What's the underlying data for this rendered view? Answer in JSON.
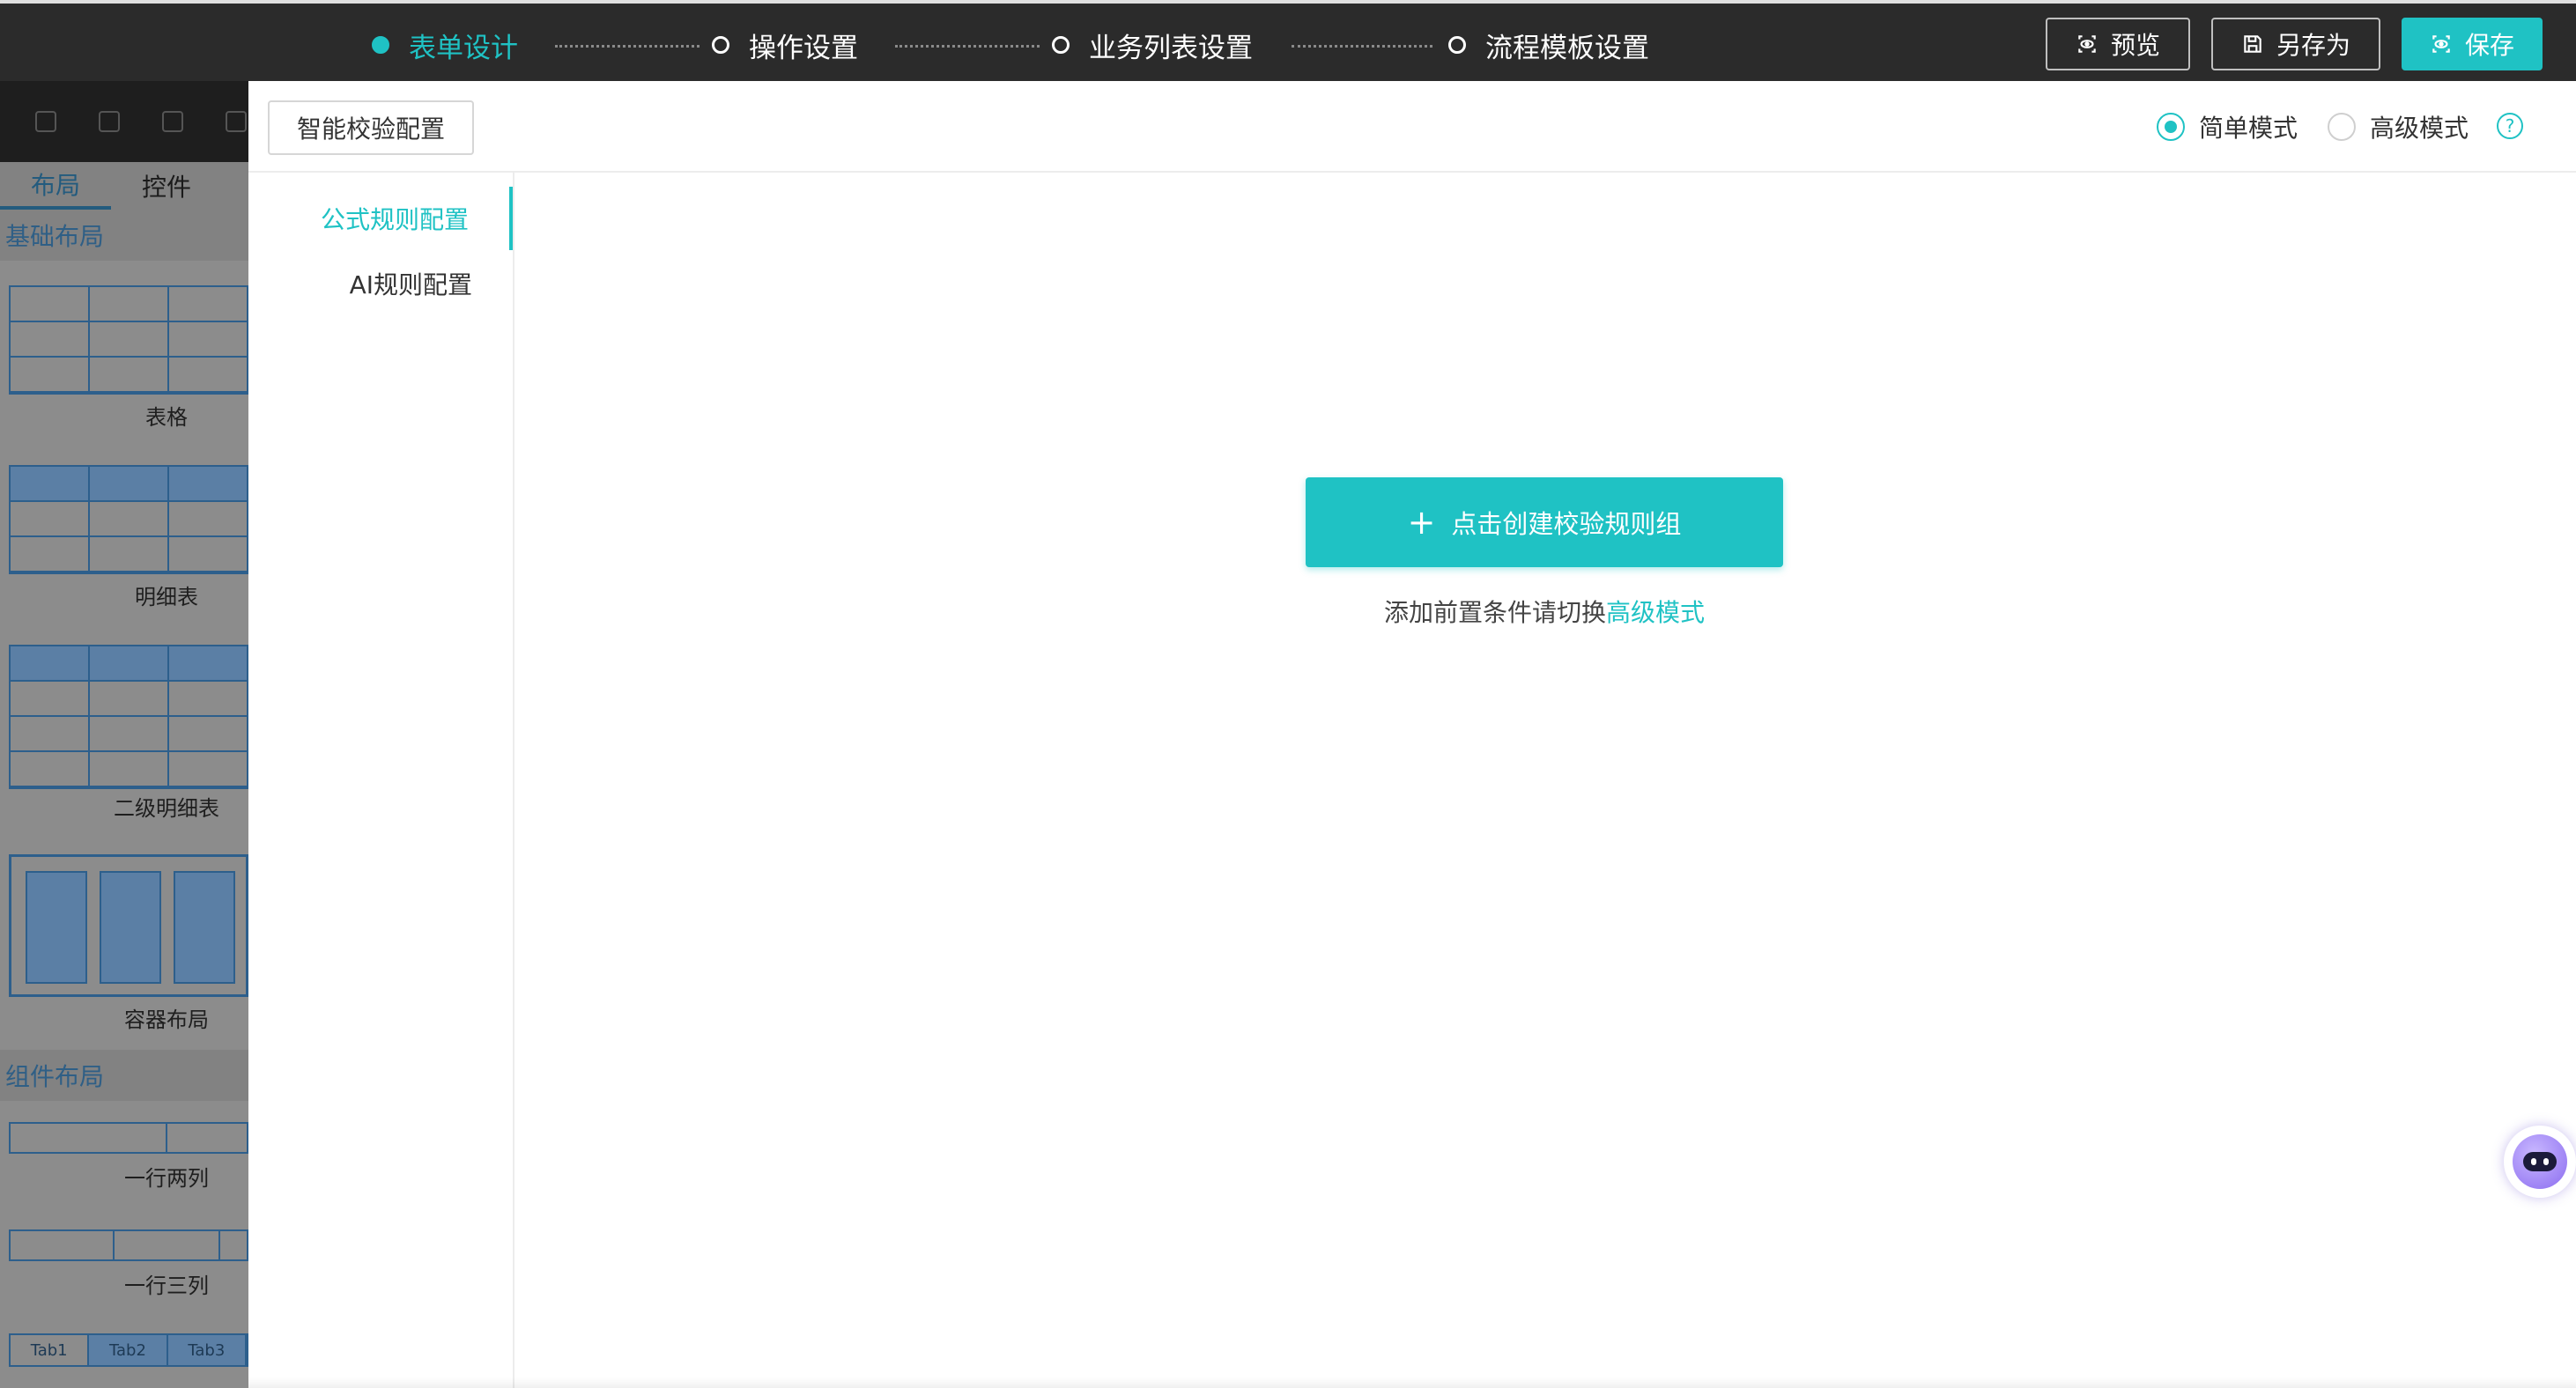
{
  "topbar": {
    "steps": [
      {
        "label": "表单设计",
        "active": true
      },
      {
        "label": "操作设置",
        "active": false
      },
      {
        "label": "业务列表设置",
        "active": false
      },
      {
        "label": "流程模板设置",
        "active": false
      }
    ],
    "preview_label": "预览",
    "save_as_label": "另存为",
    "save_label": "保存"
  },
  "left_panel": {
    "tabs": [
      "布局",
      "控件"
    ],
    "sections": [
      {
        "title": "基础布局"
      },
      {
        "title": "组件布局"
      }
    ],
    "widgets": {
      "table": "表格",
      "detail_table": "明细表",
      "sub_detail_table": "二级明细表",
      "container_layout": "容器布局",
      "two_columns": "一行两列",
      "three_columns": "一行三列"
    },
    "tab_widget": [
      "Tab1",
      "Tab2",
      "Tab3"
    ]
  },
  "dialog": {
    "smart_check_button": "智能校验配置",
    "modes": [
      {
        "label": "简单模式",
        "selected": true
      },
      {
        "label": "高级模式",
        "selected": false
      }
    ],
    "help_icon": "?",
    "nav": [
      {
        "label": "公式规则配置",
        "active": true
      },
      {
        "label": "AI规则配置",
        "active": false
      }
    ],
    "create_button": {
      "icon": "+",
      "label": "点击创建校验规则组"
    },
    "hint_prefix": "添加前置条件请切换",
    "hint_link": "高级模式"
  },
  "colors": {
    "accent": "#1fc2c4",
    "topbar_bg": "#2b2b2b"
  }
}
